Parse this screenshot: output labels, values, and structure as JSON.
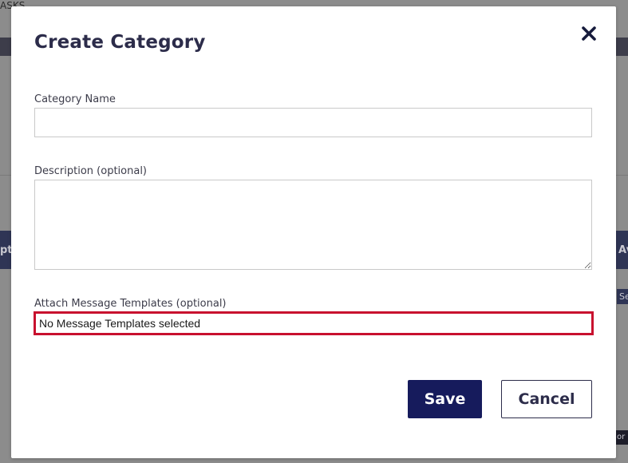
{
  "background": {
    "top_left_text": "ASKS",
    "left_header_fragment": "pt",
    "right_header_fragment": "Av",
    "right_chip_text": "Se",
    "bottom_chip_text": "or"
  },
  "modal": {
    "title": "Create Category",
    "close_icon": "close-icon",
    "fields": {
      "category_name": {
        "label": "Category Name",
        "value": "",
        "placeholder": ""
      },
      "description": {
        "label": "Description (optional)",
        "value": "",
        "placeholder": ""
      },
      "message_templates": {
        "label": "Attach Message Templates (optional)",
        "value": "No Message Templates selected"
      }
    },
    "buttons": {
      "save_label": "Save",
      "cancel_label": "Cancel"
    }
  },
  "colors": {
    "primary": "#161b5c",
    "error_border": "#c8102e",
    "title_text": "#2c2c4a"
  }
}
